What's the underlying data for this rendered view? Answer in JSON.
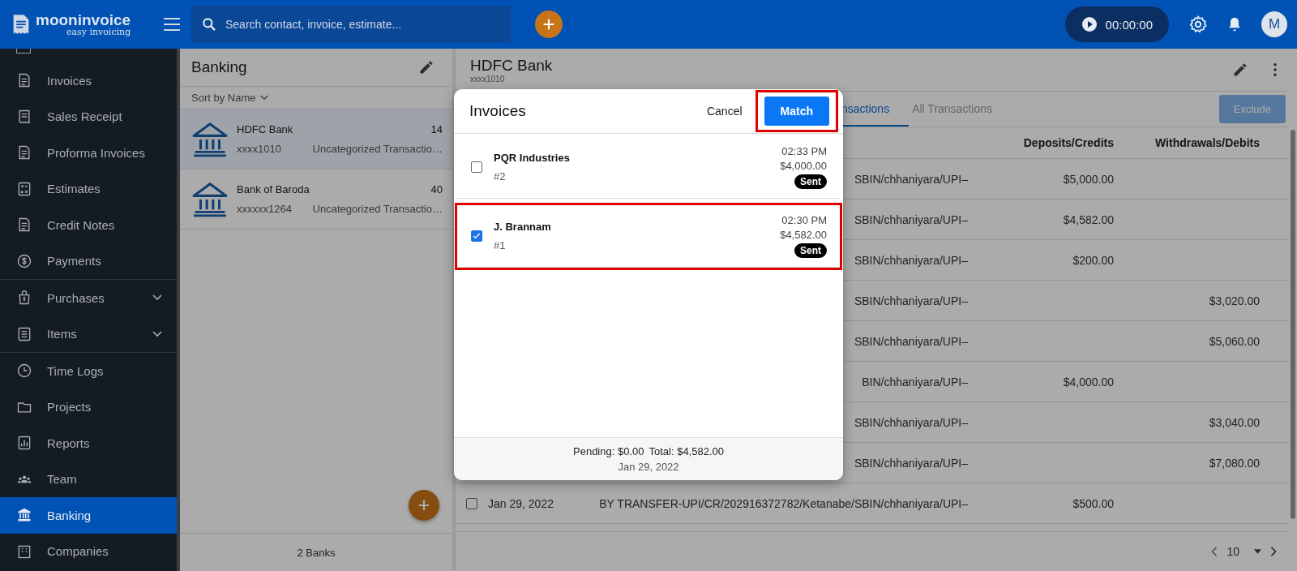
{
  "topbar": {
    "logo_name": "mooninvoice",
    "logo_tagline": "easy invoicing",
    "search": {
      "placeholder": "Search contact, invoice, estimate..."
    },
    "timer": "00:00:00",
    "avatar": "M"
  },
  "sidebar": {
    "items": [
      {
        "label": "Invoices",
        "selected": false,
        "expandable": false
      },
      {
        "label": "Sales Receipt",
        "selected": false,
        "expandable": false
      },
      {
        "label": "Proforma Invoices",
        "selected": false,
        "expandable": false
      },
      {
        "label": "Estimates",
        "selected": false,
        "expandable": false
      },
      {
        "label": "Credit Notes",
        "selected": false,
        "expandable": false
      },
      {
        "label": "Payments",
        "selected": false,
        "expandable": false
      },
      {
        "label": "Purchases",
        "selected": false,
        "expandable": true
      },
      {
        "label": "Items",
        "selected": false,
        "expandable": true
      },
      {
        "label": "Time Logs",
        "selected": false,
        "expandable": false
      },
      {
        "label": "Projects",
        "selected": false,
        "expandable": false
      },
      {
        "label": "Reports",
        "selected": false,
        "expandable": false
      },
      {
        "label": "Team",
        "selected": false,
        "expandable": false
      },
      {
        "label": "Banking",
        "selected": true,
        "expandable": false
      },
      {
        "label": "Companies",
        "selected": false,
        "expandable": false
      }
    ]
  },
  "banks_panel": {
    "title": "Banking",
    "sort": "Sort by Name",
    "footer": "2 Banks",
    "banks": [
      {
        "name": "HDFC Bank",
        "account": "xxxx1010",
        "count": "14",
        "subtitle": "Uncategorized Transactio…",
        "selected": true
      },
      {
        "name": "Bank of Baroda",
        "account": "xxxxxx1264",
        "count": "40",
        "subtitle": "Uncategorized Transactio…",
        "selected": false
      }
    ]
  },
  "detail": {
    "title": "HDFC Bank",
    "account": "xxxx1010",
    "tabs": [
      {
        "label": "nsactions",
        "selected": true
      },
      {
        "label": "All Transactions",
        "selected": false
      }
    ],
    "exclude_button": "Exclude",
    "columns": [
      "Deposits/Credits",
      "Withdrawals/Debits"
    ],
    "rows": [
      {
        "description": "SBIN/chhaniyara/UPI–",
        "deposit": "$5,000.00",
        "withdrawal": ""
      },
      {
        "description": "SBIN/chhaniyara/UPI–",
        "deposit": "$4,582.00",
        "withdrawal": ""
      },
      {
        "description": "SBIN/chhaniyara/UPI–",
        "deposit": "$200.00",
        "withdrawal": ""
      },
      {
        "description": "SBIN/chhaniyara/UPI–",
        "deposit": "",
        "withdrawal": "$3,020.00"
      },
      {
        "description": "SBIN/chhaniyara/UPI–",
        "deposit": "",
        "withdrawal": "$5,060.00"
      },
      {
        "description": "BIN/chhaniyara/UPI–",
        "deposit": "$4,000.00",
        "withdrawal": ""
      },
      {
        "description": "SBIN/chhaniyara/UPI–",
        "deposit": "",
        "withdrawal": "$3,040.00"
      },
      {
        "description": "SBIN/chhaniyara/UPI–",
        "deposit": "",
        "withdrawal": "$7,080.00"
      },
      {
        "date": "Jan 29, 2022",
        "checked": false,
        "description": "BY TRANSFER-UPI/CR/202916372782/Ketanabe/SBIN/chhaniyara/UPI–",
        "deposit": "$500.00",
        "withdrawal": ""
      }
    ],
    "page_size": "10"
  },
  "modal": {
    "title": "Invoices",
    "cancel": "Cancel",
    "match": "Match",
    "match_highlighted": true,
    "invoices": [
      {
        "name": "PQR Industries",
        "number": "#2",
        "time": "02:33 PM",
        "amount": "$4,000.00",
        "status": "Sent",
        "checked": false,
        "highlighted": false
      },
      {
        "name": "J. Brannam",
        "number": "#1",
        "time": "02:30 PM",
        "amount": "$4,582.00",
        "status": "Sent",
        "checked": true,
        "highlighted": true
      }
    ],
    "pending": "Pending: $0.00",
    "total": "Total: $4,582.00",
    "date": "Jan 29, 2022"
  }
}
